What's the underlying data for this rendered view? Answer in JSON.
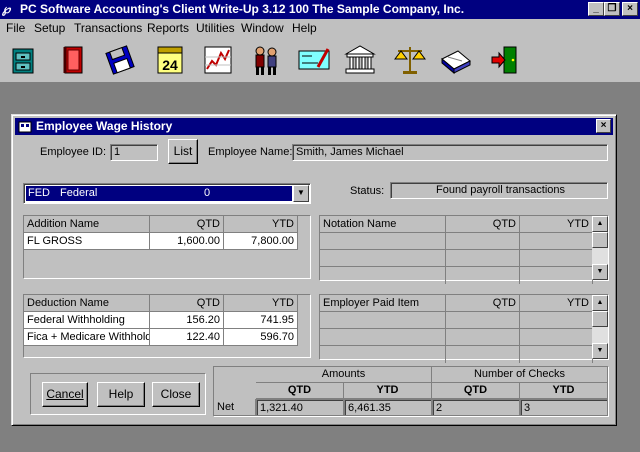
{
  "app": {
    "title": "PC Software Accounting's Client Write-Up 3.12     100 The Sample Company, Inc.",
    "icon": "pc-logo-icon",
    "controls": [
      "_",
      "❐",
      "×"
    ]
  },
  "menu": [
    "File",
    "Setup",
    "Transactions",
    "Reports",
    "Utilities",
    "Window",
    "Help"
  ],
  "toolbar": [
    {
      "name": "cabinet-icon"
    },
    {
      "name": "book-icon"
    },
    {
      "name": "disk-icon"
    },
    {
      "name": "calendar-icon",
      "text": "24"
    },
    {
      "name": "chart-icon"
    },
    {
      "name": "people-icon"
    },
    {
      "name": "check-icon"
    },
    {
      "name": "bank-icon"
    },
    {
      "name": "scales-icon"
    },
    {
      "name": "ledger-icon"
    },
    {
      "name": "exit-icon"
    }
  ],
  "dialog": {
    "title": "Employee Wage History",
    "close_glyph": "×",
    "employee_id_label": "Employee ID:",
    "employee_id": "1",
    "list_button": "List",
    "employee_name_label": "Employee Name:",
    "employee_name": "Smith, James Michael",
    "tax_select": {
      "code": "FED",
      "name": "Federal",
      "value": "0"
    },
    "status_label": "Status:",
    "status": "Found payroll transactions",
    "additions": {
      "headers": [
        "Addition Name",
        "QTD",
        "YTD"
      ],
      "rows": [
        [
          "FL GROSS",
          "1,600.00",
          "7,800.00"
        ]
      ]
    },
    "notations": {
      "headers": [
        "Notation Name",
        "QTD",
        "YTD"
      ]
    },
    "deductions": {
      "headers": [
        "Deduction Name",
        "QTD",
        "YTD"
      ],
      "rows": [
        [
          "Federal Withholding",
          "156.20",
          "741.95"
        ],
        [
          "Fica + Medicare Withholding",
          "122.40",
          "596.70"
        ]
      ]
    },
    "employer_paid": {
      "headers": [
        "Employer Paid Item",
        "QTD",
        "YTD"
      ]
    },
    "buttons": {
      "cancel": "Cancel",
      "help": "Help",
      "close": "Close"
    },
    "summary": {
      "amounts_label": "Amounts",
      "checks_label": "Number of Checks",
      "qtd_label": "QTD",
      "ytd_label": "YTD",
      "net_label": "Net",
      "amount_qtd": "1,321.40",
      "amount_ytd": "6,461.35",
      "checks_qtd": "2",
      "checks_ytd": "3"
    }
  }
}
